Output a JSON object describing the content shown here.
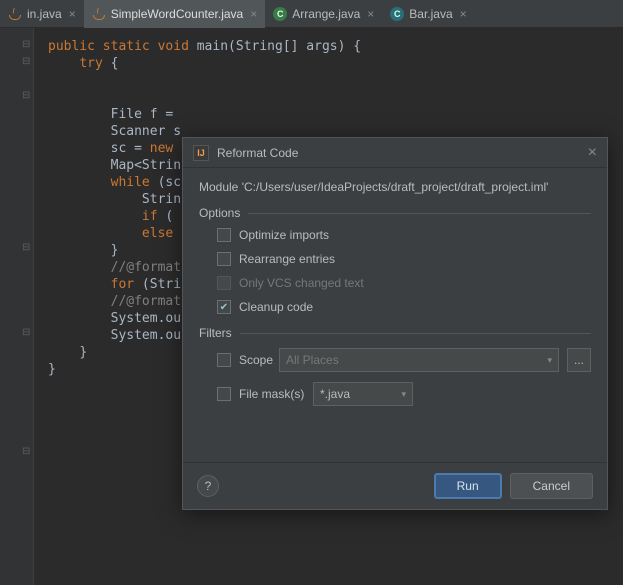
{
  "tabs": [
    {
      "label": "in.java"
    },
    {
      "label": "SimpleWordCounter.java"
    },
    {
      "label": "Arrange.java"
    },
    {
      "label": "Bar.java"
    }
  ],
  "code": {
    "l1a": "public",
    "l1b": " static",
    "l1c": " void",
    "l1d": " main(String[] args) {",
    "l2a": "try",
    "l2b": " {",
    "l3": "File f = ",
    "l4": "Scanner s",
    "l5a": "sc = ",
    "l5b": "new",
    "l6": "Map<Strin",
    "l7a": "while",
    "l7b": " (sc",
    "l8": "Strin",
    "l9a": "if",
    "l9b": " (",
    "l10": "else",
    "l11": "}",
    "l12": "//@format",
    "l13a": "for",
    "l13b": " (Stri",
    "l14": "//@format",
    "l15": "System.ou",
    "l16": "System.ou",
    "l17": "}",
    "l18": "}",
    "l19": "}"
  },
  "dialog": {
    "title": "Reformat Code",
    "module": "Module 'C:/Users/user/IdeaProjects/draft_project/draft_project.iml'",
    "options_header": "Options",
    "opt_optimize": "Optimize imports",
    "opt_rearrange": "Rearrange entries",
    "opt_vcs": "Only VCS changed text",
    "opt_cleanup": "Cleanup code",
    "filters_header": "Filters",
    "scope_label": "Scope",
    "scope_value": "All Places",
    "dots": "...",
    "mask_label": "File mask(s)",
    "mask_value": "*.java",
    "help": "?",
    "run": "Run",
    "cancel": "Cancel",
    "arrow": "▾"
  },
  "icons": {
    "c_glyph": "C"
  }
}
